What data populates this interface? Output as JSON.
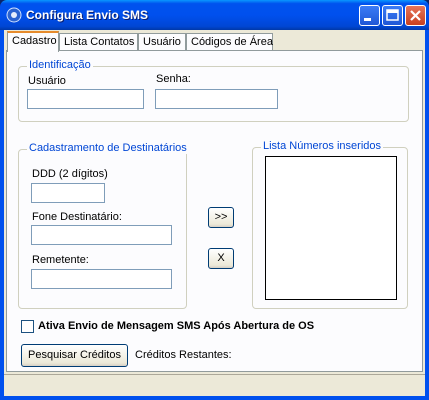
{
  "window": {
    "title": "Configura Envio SMS",
    "app_icon": "app-gear-icon",
    "controls": [
      "minimize-icon",
      "maximize-icon",
      "close-icon"
    ]
  },
  "tabs": [
    {
      "label": "Cadastro",
      "active": true
    },
    {
      "label": "Lista Contatos",
      "active": false
    },
    {
      "label": "Usuário",
      "active": false
    },
    {
      "label": "Códigos de Área",
      "active": false
    }
  ],
  "identificacao": {
    "title": "Identificação",
    "usuario_label": "Usuário",
    "usuario_value": "",
    "senha_label": "Senha:",
    "senha_value": ""
  },
  "destinatarios": {
    "title": "Cadastramento de Destinatários",
    "ddd_label": "DDD (2 dígitos)",
    "ddd_value": "",
    "fone_label": "Fone Destinatário:",
    "fone_value": "",
    "remetente_label": "Remetente:",
    "remetente_value": ""
  },
  "actions": {
    "add_label": ">>",
    "remove_label": "X"
  },
  "lista": {
    "title": "Lista Números inseridos",
    "items": []
  },
  "options": {
    "ativa_envio_label": "Ativa Envio de Mensagem SMS Após Abertura de OS",
    "ativa_envio_checked": false
  },
  "creditos": {
    "button_label": "Pesquisar Créditos",
    "restantes_label": "Créditos Restantes:",
    "restantes_value": ""
  },
  "colors": {
    "titlebar": "#0050ee",
    "group_title": "#0046d5",
    "client_bg": "#ece9d8",
    "tab_accent": "#e68b2c"
  }
}
